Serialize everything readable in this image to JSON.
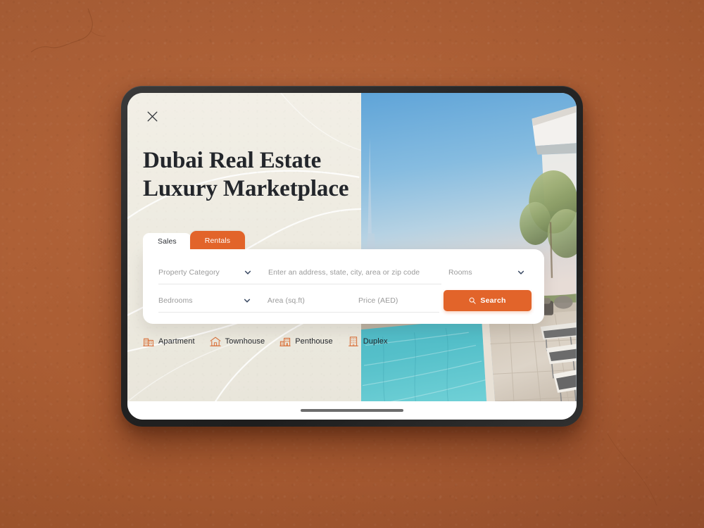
{
  "scene": {
    "background_color": "#ad5f35",
    "device_frame_color": "#262626",
    "panel_color": "#eeebe1",
    "accent_color": "#e2642a",
    "text_color": "#23262b"
  },
  "app": {
    "close_icon": "close-icon",
    "headline_line1": "Dubai Real Estate",
    "headline_line2": "Luxury Marketplace"
  },
  "tabs": [
    {
      "label": "Sales",
      "active": true,
      "style": "plain"
    },
    {
      "label": "Rentals",
      "active": false,
      "style": "pill"
    }
  ],
  "search_form": {
    "category": {
      "placeholder": "Property Category",
      "value": "",
      "icon": "chevron-down-icon"
    },
    "address": {
      "placeholder": "Enter an address, state, city, area or zip code",
      "value": ""
    },
    "rooms": {
      "placeholder": "Rooms",
      "value": "",
      "icon": "chevron-down-icon"
    },
    "bedrooms": {
      "placeholder": "Bedrooms",
      "value": "",
      "icon": "chevron-down-icon"
    },
    "area": {
      "placeholder": "Area (sq.ft)",
      "value": ""
    },
    "price": {
      "placeholder": "Price (AED)",
      "value": ""
    },
    "search_button": {
      "label": "Search",
      "icon": "search-icon"
    }
  },
  "property_types": [
    {
      "label": "Apartment",
      "icon": "apartment-building-icon"
    },
    {
      "label": "Townhouse",
      "icon": "house-roof-icon"
    },
    {
      "label": "Penthouse",
      "icon": "penthouse-building-icon"
    },
    {
      "label": "Duplex",
      "icon": "duplex-building-icon"
    }
  ],
  "photo": {
    "description": "Rooftop swimming pool with sun loungers, palm trees and Dubai skyline with tall spire",
    "sky_color": "#7fb4dd",
    "pool_color": "#49b4c2",
    "deck_color": "#d8cfc2"
  },
  "system": {
    "home_indicator": "home-indicator"
  }
}
